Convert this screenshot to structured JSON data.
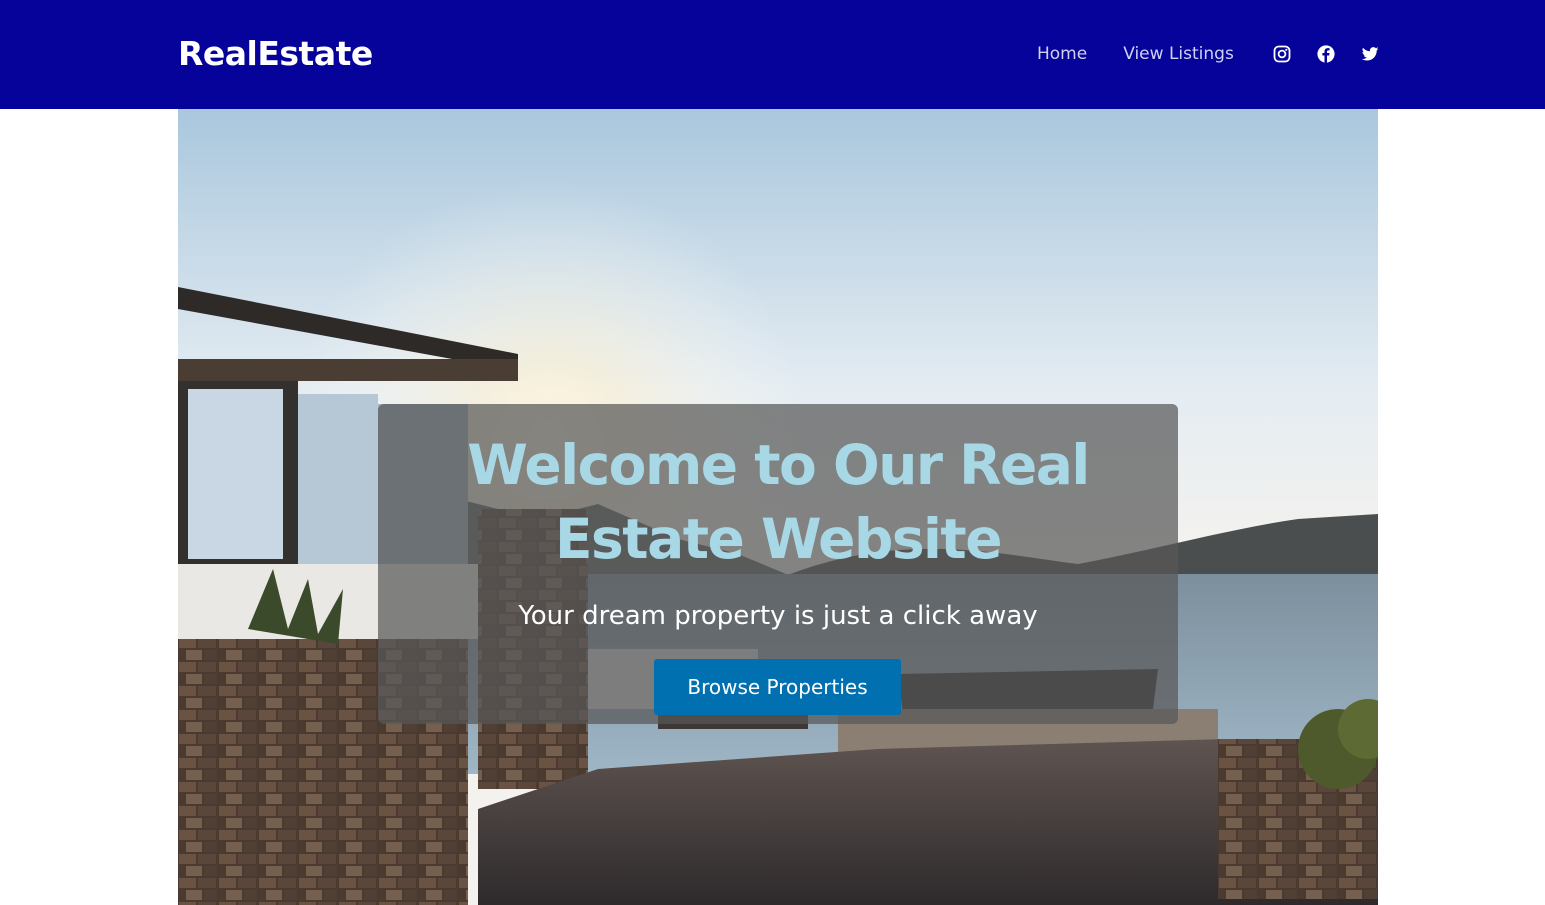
{
  "brand": "RealEstate",
  "nav": {
    "links": [
      "Home",
      "View Listings"
    ],
    "social_icons": [
      "instagram-icon",
      "facebook-icon",
      "twitter-icon"
    ]
  },
  "hero": {
    "title": "Welcome to Our Real Estate Website",
    "subtitle": "Your dream property is just a click away",
    "cta_label": "Browse Properties",
    "image_alt": "Modern villa with stone walls overlooking the sea at sunset"
  },
  "colors": {
    "navbar_bg": "#050399",
    "title_color": "#a8d8e6",
    "cta_bg": "#0070b0"
  }
}
